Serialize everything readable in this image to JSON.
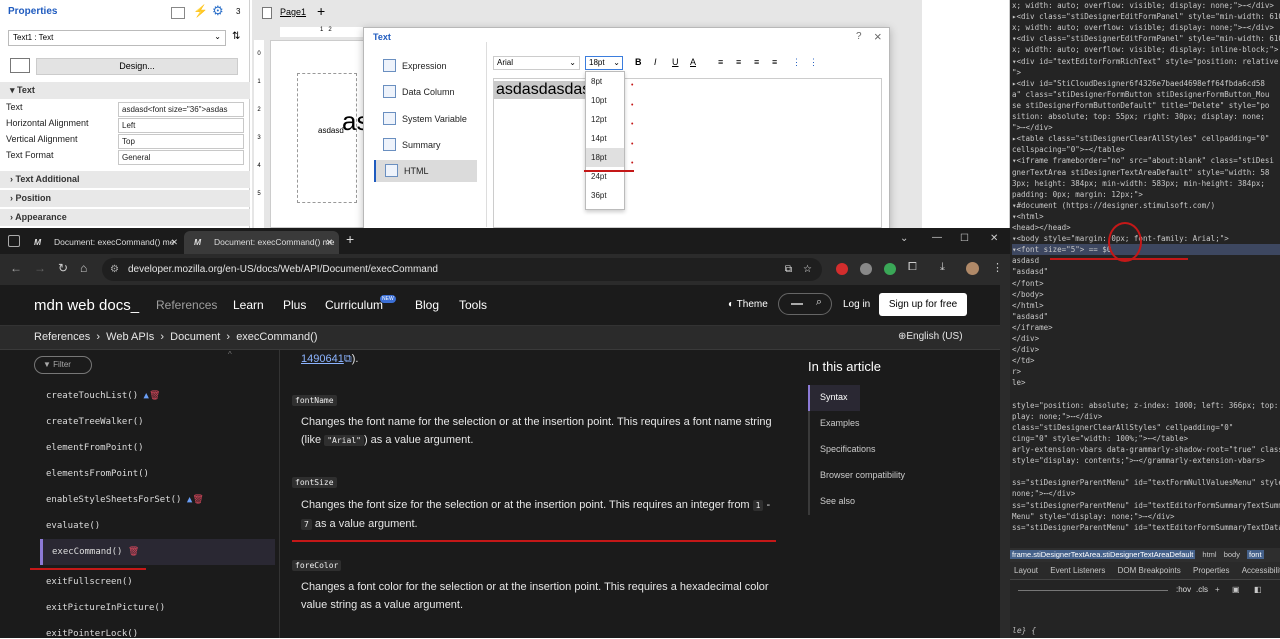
{
  "designer": {
    "properties": {
      "title": "Properties",
      "badge": "3",
      "component": "Text1 : Text",
      "design_button": "Design...",
      "section_text": "Text",
      "rows": [
        {
          "label": "Text",
          "value": "asdasd<font size=\"36\">asdas"
        },
        {
          "label": "Horizontal Alignment",
          "value": "Left"
        },
        {
          "label": "Vertical Alignment",
          "value": "Top"
        },
        {
          "label": "Text Format",
          "value": "General"
        }
      ],
      "sections": [
        "Text Additional",
        "Position",
        "Appearance"
      ]
    },
    "page_tab": "Page1",
    "add_tab": "+",
    "canvas_small_text": "asdasd",
    "canvas_big_text": "as",
    "ruler": [
      "1",
      "2"
    ],
    "left_ruler": [
      "0",
      "1",
      "2",
      "3",
      "4",
      "5"
    ],
    "dialog": {
      "title": "Text",
      "help": "?",
      "close": "×",
      "items": [
        "Expression",
        "Data Column",
        "System Variable",
        "Summary",
        "HTML"
      ],
      "font": "Arial",
      "size": "18pt",
      "sizes": [
        "8pt",
        "10pt",
        "12pt",
        "14pt",
        "18pt",
        "24pt",
        "36pt"
      ],
      "editor_text": "asdasdasdas",
      "bold": "B",
      "italic": "I",
      "underline": "U",
      "color_a": "A"
    }
  },
  "devtools": {
    "lines": [
      {
        "t": "x; width: auto; overflow: visible; display: none;\">⋯</div>"
      },
      {
        "t": "▸<div class=\"stiDesignerEditFormPanel\" style=\"min-width: 610p"
      },
      {
        "t": "x; width: auto; overflow: visible; display: none;\">⋯</div>"
      },
      {
        "t": "▾<div class=\"stiDesignerEditFormPanel\" style=\"min-width: 610p"
      },
      {
        "t": "x; width: auto; overflow: visible; display: inline-block;\">"
      },
      {
        "t": "  ▾<div id=\"textEditorFormRichText\" style=\"position: relative;"
      },
      {
        "t": "   \">"
      },
      {
        "t": "   ▸<div id=\"StiCloudDesigner6f4326e7baed4698eff64fbda6cd58"
      },
      {
        "t": "    a\" class=\"stiDesignerFormButton stiDesignerFormButton_Mou"
      },
      {
        "t": "    se stiDesignerFormButtonDefault\" title=\"Delete\" style=\"po"
      },
      {
        "t": "    sition: absolute; top: 55px; right: 30px; display: none;"
      },
      {
        "t": "    \">⋯</div>"
      },
      {
        "t": "   ▸<table class=\"stiDesignerClearAllStyles\" cellpadding=\"0\""
      },
      {
        "t": "    cellspacing=\"0\">⋯</table>"
      },
      {
        "t": "   ▾<iframe frameborder=\"no\" src=\"about:blank\" class=\"stiDesi"
      },
      {
        "t": "    gnerTextArea stiDesignerTextAreaDefault\" style=\"width: 58"
      },
      {
        "t": "    3px; height: 384px; min-width: 583px; min-height: 384px;"
      },
      {
        "t": "    padding: 0px; margin: 12px;\">"
      },
      {
        "t": "    ▾#document (https://designer.stimulsoft.com/)"
      },
      {
        "t": "      ▾<html>"
      },
      {
        "t": "         <head></head>"
      },
      {
        "t": "       ▾<body style=\"margin: 0px; font-family: Arial;\">"
      },
      {
        "t": "        ▾<font size=\"5\"> == $0"
      },
      {
        "t": "            asdasd"
      },
      {
        "t": "           \"asdasd\""
      },
      {
        "t": "          </font>"
      },
      {
        "t": "         </body>"
      },
      {
        "t": "       </html>"
      },
      {
        "t": "      \"asdasd\""
      },
      {
        "t": "     </iframe>"
      },
      {
        "t": "    </div>"
      },
      {
        "t": "  </div>"
      },
      {
        "t": "</td>"
      },
      {
        "t": "r>"
      },
      {
        "t": "le>"
      },
      {
        "t": ""
      },
      {
        "t": "style=\"position: absolute; z-index: 1000; left: 366px; top: 175"
      },
      {
        "t": "play: none;\">⋯</div>"
      },
      {
        "t": "class=\"stiDesignerClearAllStyles\" cellpadding=\"0\""
      },
      {
        "t": "cing=\"0\" style=\"width: 100%;\">⋯</table>"
      },
      {
        "t": "arly-extension-vbars data-grammarly-shadow-root=\"true\" class="
      },
      {
        "t": " style=\"display: contents;\">⋯</grammarly-extension-vbars>"
      },
      {
        "t": ""
      },
      {
        "t": "ss=\"stiDesignerParentMenu\" id=\"textFormNullValuesMenu\" style="
      },
      {
        "t": " none;\">⋯</div>"
      },
      {
        "t": "ss=\"stiDesignerParentMenu\" id=\"textEditorFormSummaryTextSummar"
      },
      {
        "t": "Menu\" style=\"display: none;\">⋯</div>"
      },
      {
        "t": "ss=\"stiDesignerParentMenu\" id=\"textEditorFormSummaryTextDataBa"
      }
    ],
    "path": [
      "frame.stiDesignerTextArea.stiDesignerTextAreaDefault",
      "html",
      "body",
      "font"
    ],
    "tabs": [
      "Layout",
      "Event Listeners",
      "DOM Breakpoints",
      "Properties",
      "Accessibility"
    ],
    "filter_hov": ":hov",
    "filter_cls": ".cls",
    "bottom": "le} {"
  },
  "browser": {
    "tabs": [
      {
        "title": "Document: execCommand() me"
      },
      {
        "title": "Document: execCommand() me"
      }
    ],
    "new_tab": "+",
    "url": "developer.mozilla.org/en-US/docs/Web/API/Document/execCommand",
    "nav": {
      "logo": "mdn web docs_",
      "links": [
        "References",
        "Learn",
        "Plus",
        "Curriculum",
        "Blog",
        "Tools"
      ],
      "new_badge": "NEW",
      "theme": "Theme",
      "login": "Log in",
      "signup": "Sign up for free"
    },
    "breadcrumb": [
      "References",
      "Web APIs",
      "Document",
      "execCommand()"
    ],
    "language": "English (US)",
    "filter_placeholder": "Filter",
    "sidebar_items": [
      "createTouchList()",
      "createTreeWalker()",
      "elementFromPoint()",
      "elementsFromPoint()",
      "enableStyleSheetsForSet()",
      "evaluate()",
      "execCommand()",
      "exitFullscreen()",
      "exitPictureInPicture()",
      "exitPointerLock()"
    ],
    "content": {
      "bug_link": "1490641",
      "bug_after": ").",
      "blocks": [
        {
          "code": "fontName",
          "text_before": "Changes the font name for the selection or at the insertion point. This requires a font name string (like ",
          "inline": "\"Arial\"",
          "text_after": ") as a value argument."
        },
        {
          "code": "fontSize",
          "text_before": "Changes the font size for the selection or at the insertion point. This requires an integer from ",
          "inline": "1",
          "mid": " - ",
          "inline2": "7",
          "text_after": " as a value argument."
        },
        {
          "code": "foreColor",
          "text_before": "Changes a font color for the selection or at the insertion point. This requires a hexadecimal color value string as a value argument."
        }
      ]
    },
    "toc": {
      "title": "In this article",
      "items": [
        "Syntax",
        "Examples",
        "Specifications",
        "Browser compatibility",
        "See also"
      ]
    }
  }
}
